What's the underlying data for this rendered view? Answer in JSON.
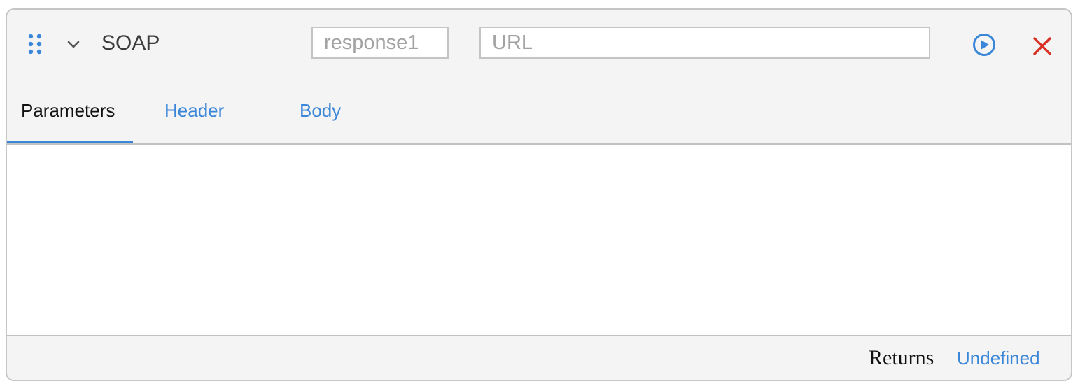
{
  "node": {
    "title": "SOAP",
    "variable_placeholder": "response1",
    "variable_value": "",
    "url_placeholder": "URL",
    "url_value": ""
  },
  "icons": {
    "drag": "drag-handle-icon",
    "collapse": "chevron-down-icon",
    "run": "play-circle-icon",
    "close": "close-icon"
  },
  "tabs": [
    {
      "label": "Parameters",
      "active": true
    },
    {
      "label": "Header",
      "active": false
    },
    {
      "label": "Body",
      "active": false
    }
  ],
  "footer": {
    "returns_label": "Returns",
    "returns_value": "Undefined"
  },
  "colors": {
    "accent": "#3a86d8",
    "close": "#d93025",
    "card_bg": "#f4f4f4",
    "panel_bg": "#ffffff"
  }
}
